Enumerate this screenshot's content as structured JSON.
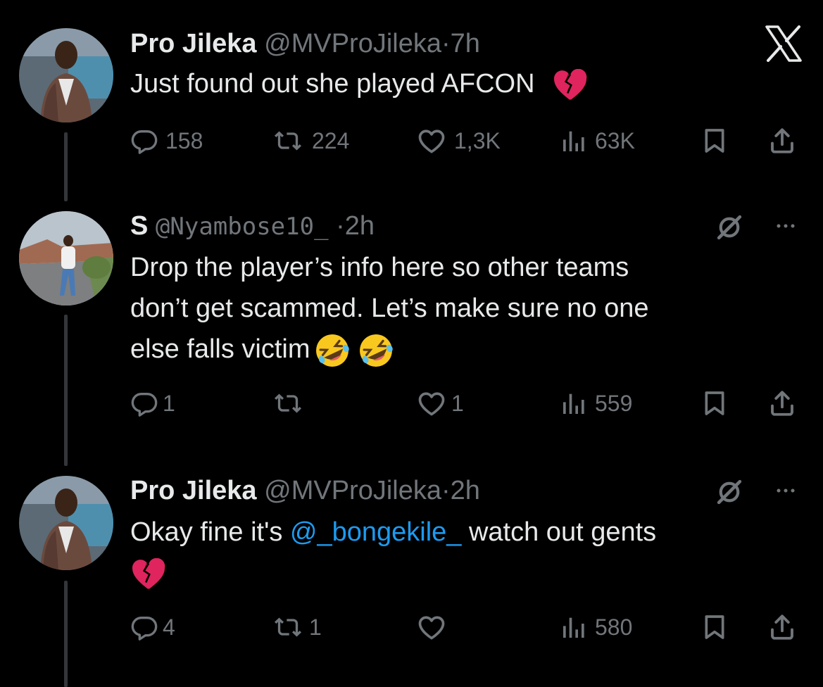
{
  "close_icon": "x-logo",
  "tweets": [
    {
      "name": "Pro Jileka",
      "handle": "@MVProJileka",
      "dot": "·",
      "time": "7h",
      "text": "Just found out she played AFCON",
      "emoji": "broken-heart",
      "replies": "158",
      "reposts": "224",
      "likes": "1,3K",
      "views": "63K"
    },
    {
      "name": "S",
      "handle": "@Nyambose10_",
      "dot": "·",
      "time": "2h",
      "lines": [
        "Drop the player’s info here so other teams",
        "don’t get scammed. Let’s make sure no one",
        "else falls victim"
      ],
      "emoji": "rolling-on-floor-laughing x2",
      "replies": "1",
      "reposts": "",
      "likes": "1",
      "views": "559"
    },
    {
      "name": "Pro Jileka",
      "handle": "@MVProJileka",
      "dot": "·",
      "time": "2h",
      "text_before": "Okay fine it's ",
      "mention": "@_bongekile_",
      "text_after": " watch out gents",
      "emoji": "broken-heart",
      "replies": "4",
      "reposts": "1",
      "likes": "",
      "views": "580"
    }
  ],
  "colors": {
    "background": "#000000",
    "text": "#e7e9ea",
    "muted": "#71767b",
    "link": "#1d9bf0",
    "thread": "#333639",
    "heart": "#e0245e"
  }
}
